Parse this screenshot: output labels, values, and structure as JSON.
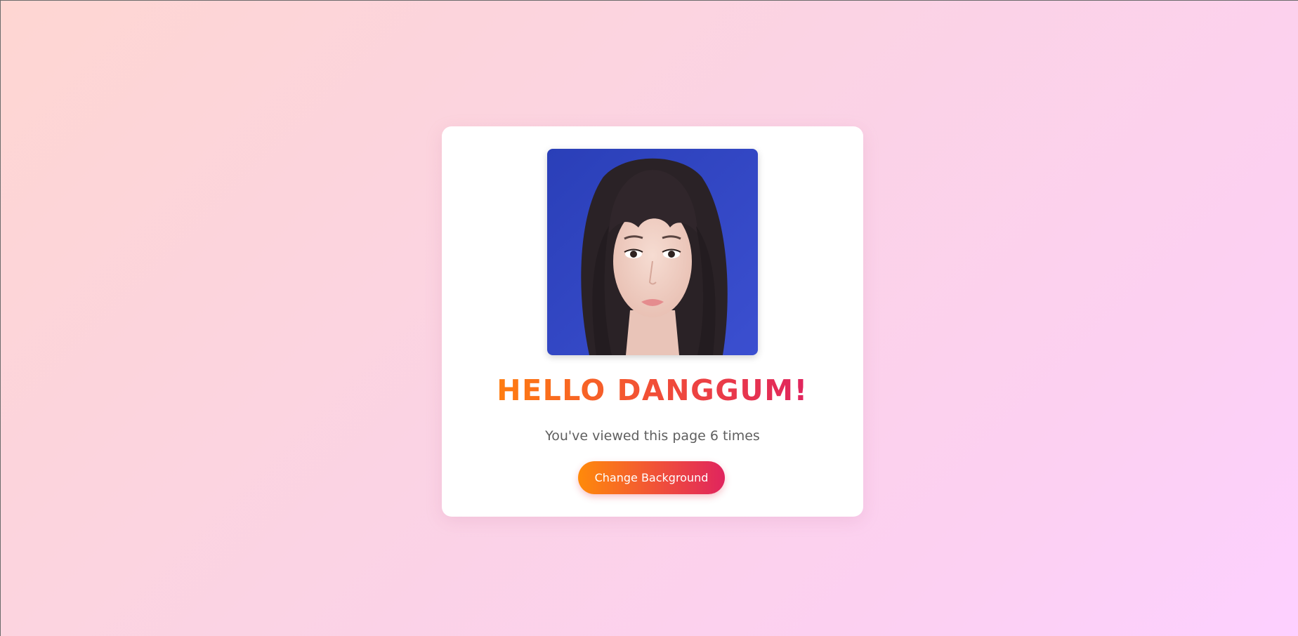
{
  "card": {
    "title": "HELLO DANGGUM!",
    "view_message": "You've viewed this page 6 times",
    "view_count": 6,
    "button_label": "Change Background"
  },
  "colors": {
    "background_start": "#fed6d2",
    "background_end": "#fdd0ff",
    "accent_orange": "#ff7d10",
    "accent_pink": "#e0245e",
    "card": "#ffffff",
    "text_muted": "#5f5f5f"
  }
}
